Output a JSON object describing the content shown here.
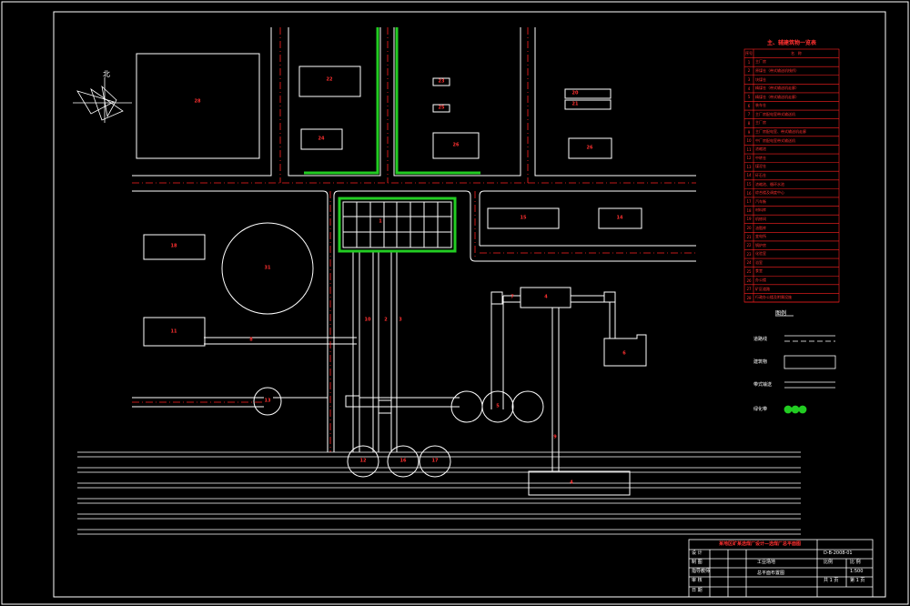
{
  "colors": {
    "background": "#000000",
    "line": "#ffffff",
    "road_center": "#ff2020",
    "greenery": "#22cc22",
    "text_red": "#ff3030"
  },
  "north_arrow": {
    "label": "北"
  },
  "building_labels": {
    "b_topleft_big": "28",
    "b_top_a": "22",
    "b_top_b": "24",
    "b_small_1": "23",
    "b_small_2": "25",
    "b_mid_top": "26",
    "b_right_a": "20",
    "b_right_b": "21",
    "b_right_c": "26",
    "grid": "1",
    "b_mid_right_a": "15",
    "b_mid_right_b": "14",
    "b_left_a": "18",
    "circle_big": "31",
    "b_left_b": "11",
    "conv_left": "8",
    "conv_v1": "10",
    "conv_v2": "2",
    "conv_v3": "3",
    "box_right": "4",
    "conv_right": "7",
    "box_r2": "6",
    "circle_l": "13",
    "circle_r": "5",
    "conv_down": "9",
    "circle_b1": "12",
    "circle_b2": "16",
    "circle_b3": "17",
    "rail_box": "4"
  },
  "table": {
    "title": "主、辅建筑物一览表",
    "header": [
      "序号",
      "名",
      "称"
    ],
    "rows": [
      "主厂房",
      "原煤仓（带式输送机栈桥）",
      "块煤仓",
      "精煤仓（带式输送机走廊）",
      "精煤仓（带式输送机走廊）",
      "装车仓",
      "主厂房配电室带式输送机",
      "主厂房",
      "主厂房配电室、带式输送机走廊",
      "中厂房配电室带式输送机",
      "浓缩池",
      "中转仓",
      "煤泥仓",
      "矸石仓",
      "浓缩池、循环水池",
      "综合楼及调度中心",
      "汽车衡",
      "材料库",
      "机修间",
      "油脂库",
      "变电所",
      "锅炉房",
      "化验室",
      "浴室",
      "食堂",
      "办公楼",
      "矿区道路",
      "行政办公楼及附属设施"
    ]
  },
  "legend": {
    "title": "图例",
    "items": [
      "道路线",
      "建筑物",
      "带式输送",
      "绿化带"
    ]
  },
  "title_block": {
    "project": "某地区矿某选煤厂设计—选煤厂总平面图",
    "drawing_no": "D-B-2008-01",
    "r1": [
      "设 计",
      "",
      "",
      "工业场地",
      "比例",
      "比 例"
    ],
    "r2": [
      "制 图",
      "",
      "",
      "",
      "日期",
      "1:500"
    ],
    "r3": [
      "指导教师",
      "",
      "",
      "总平面布置图",
      "共 1 页",
      "第 1 页"
    ],
    "r4": [
      "审 核",
      "",
      "",
      "",
      "",
      ""
    ],
    "r5": [
      "日 期",
      "",
      "",
      "",
      "",
      ""
    ]
  }
}
